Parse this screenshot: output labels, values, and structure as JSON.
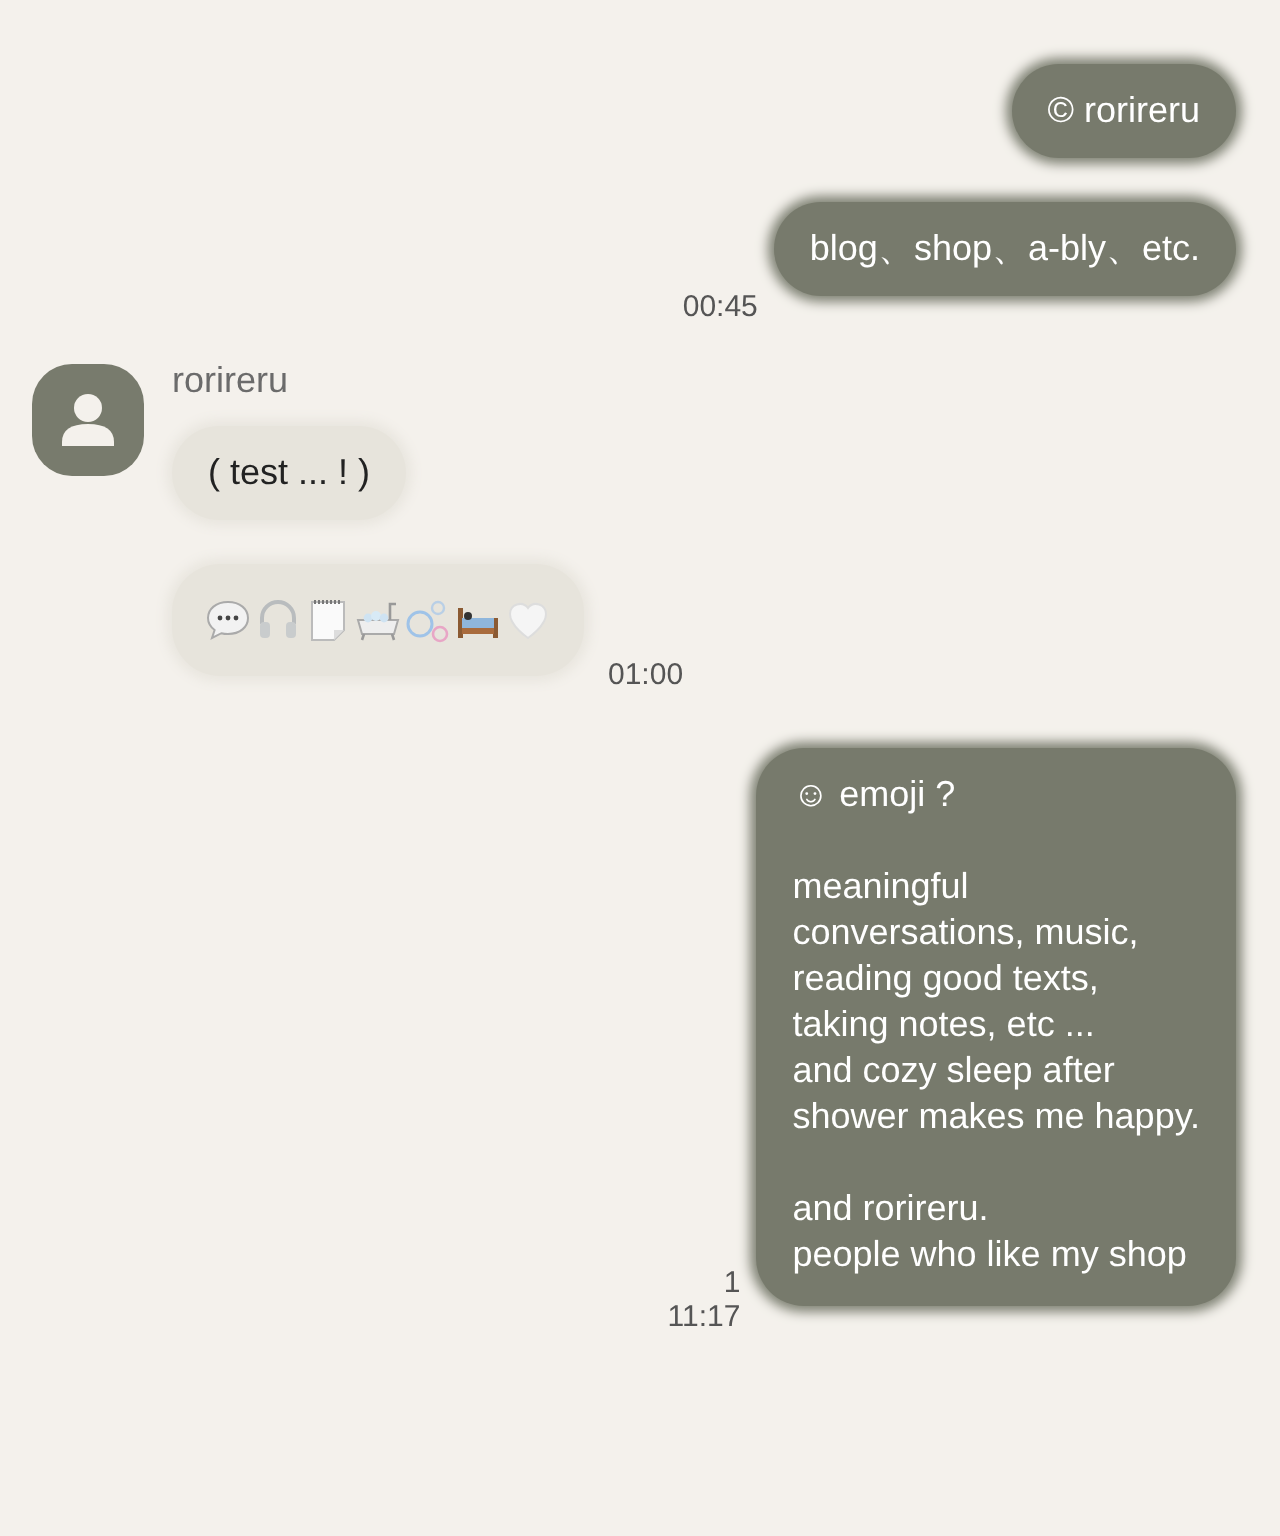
{
  "messages": [
    {
      "outgoing": true,
      "kind": "text",
      "text": "© rorireru"
    },
    {
      "outgoing": true,
      "kind": "text",
      "text": "blog、shop、a-bly、etc.",
      "time": "00:45"
    },
    {
      "outgoing": false,
      "kind": "text",
      "name": "rorireru",
      "text": "( test ... ! )"
    },
    {
      "outgoing": false,
      "kind": "icons",
      "icons": [
        {
          "kind": "speech"
        },
        {
          "kind": "headphones"
        },
        {
          "kind": "notepad"
        },
        {
          "kind": "bathtub"
        },
        {
          "kind": "bubbles"
        },
        {
          "kind": "bed"
        },
        {
          "kind": "heart"
        }
      ],
      "time": "01:00"
    },
    {
      "outgoing": true,
      "kind": "text",
      "text": "☺ emoji ?\n\nmeaningful\nconversations, music,\nreading good texts,\ntaking notes, etc ...\nand cozy sleep after\nshower makes me happy.\n\nand rorireru.\npeople who like my shop",
      "unread": "1",
      "time": "11:17"
    }
  ]
}
